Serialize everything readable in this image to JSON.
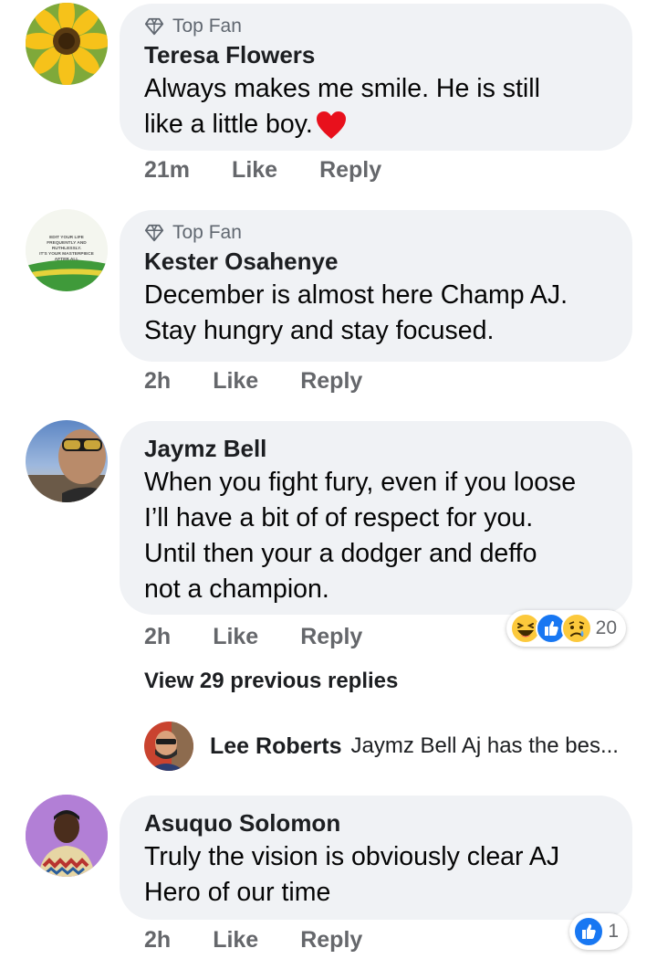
{
  "comments": [
    {
      "badge": "Top Fan",
      "author": "Teresa Flowers",
      "text_line1": "Always makes me smile. He is still",
      "text_line2": "like a little boy.",
      "time": "21m",
      "like": "Like",
      "reply": "Reply"
    },
    {
      "badge": "Top Fan",
      "author": "Kester Osahenye",
      "text_line1": "December is almost here Champ AJ.",
      "text_line2": "Stay hungry and stay focused.",
      "time": "2h",
      "like": "Like",
      "reply": "Reply",
      "avatar_text": [
        "EDIT YOUR LIFE",
        "FREQUENTLY AND",
        "RUTHLESSLY.",
        "IT'S YOUR MASTERPIECE",
        "AFTER ALL"
      ]
    },
    {
      "author": "Jaymz Bell",
      "text_line1": "When you fight fury, even if you loose",
      "text_line2": "I’ll have a bit of of respect for you.",
      "text_line3": "Until then your a dodger and deffo",
      "text_line4": "not a champion.",
      "time": "2h",
      "like": "Like",
      "reply": "Reply",
      "reaction_count": "20",
      "reaction_icons": [
        "laugh-icon",
        "like-icon",
        "sad-icon"
      ]
    },
    {
      "author": "Asuquo Solomon",
      "text_line1": "Truly the vision is obviously clear AJ",
      "text_line2": "Hero of our time",
      "time": "2h",
      "like": "Like",
      "reply": "Reply",
      "reaction_count": "1",
      "reaction_icons": [
        "like-icon"
      ]
    }
  ],
  "view_previous": "View 29 previous replies",
  "latest_reply": {
    "author": "Lee Roberts",
    "text": "Jaymz Bell Aj has the bes..."
  },
  "colors": {
    "bubble": "#f0f2f5",
    "meta": "#65676b",
    "like_blue": "#1877f2"
  }
}
